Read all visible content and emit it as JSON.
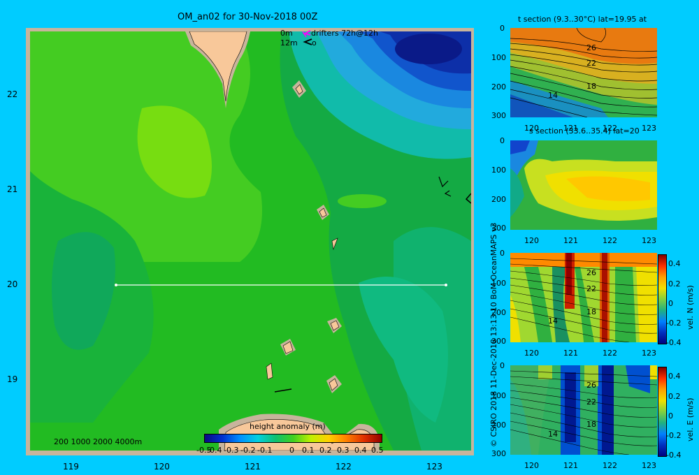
{
  "map": {
    "title": "OM_an02 for 30-Nov-2018 00Z",
    "legend_0m": "0m",
    "legend_drifters": "drifters 72h@12h",
    "legend_12m": "12m",
    "legend_12m_sym": "o",
    "lat_ticks": [
      "22",
      "21",
      "20",
      "19"
    ],
    "lon_ticks": [
      "119",
      "120",
      "121",
      "122",
      "123"
    ],
    "bathy_legend": "200  1000  2000  4000m",
    "colorbar_title": "height anomaly  (m)",
    "colorbar_ticks": [
      "-0.5",
      "-0.4",
      "-0.3",
      "-0.2",
      "-0.1",
      "0",
      "0.1",
      "0.2",
      "0.3",
      "0.4",
      "0.5"
    ]
  },
  "credit": "© CSIRO 2018   11-Dec-2018 13:13:10 BoM OceanMAPS v3",
  "panels": [
    {
      "title": "t section (9.3..30°C) lat=19.95 at",
      "y_ticks": [
        "0",
        "100",
        "200",
        "300"
      ],
      "x_ticks": [
        "120",
        "121",
        "122",
        "123"
      ],
      "contour_labels": [
        "26",
        "22",
        "18",
        "14"
      ],
      "colorbar": null
    },
    {
      "title": "s section (33.6..35.4) lat=20",
      "y_ticks": [
        "0",
        "100",
        "200",
        "300"
      ],
      "x_ticks": [
        "120",
        "121",
        "122",
        "123"
      ],
      "contour_labels": [],
      "colorbar": null
    },
    {
      "title": "",
      "y_ticks": [
        "0",
        "100",
        "200",
        "300"
      ],
      "x_ticks": [
        "120",
        "121",
        "122",
        "123"
      ],
      "contour_labels": [
        "26",
        "22",
        "18",
        "14"
      ],
      "colorbar": {
        "label": "vel. N  (m/s)",
        "ticks": [
          "0.4",
          "0.2",
          "0",
          "-0.2",
          "-0.4"
        ]
      }
    },
    {
      "title": "",
      "y_ticks": [
        "0",
        "100",
        "200",
        "300"
      ],
      "x_ticks": [
        "120",
        "121",
        "122",
        "123"
      ],
      "contour_labels": [
        "26",
        "22",
        "18",
        "14"
      ],
      "colorbar": {
        "label": "vel. E  (m/s)",
        "ticks": [
          "0.4",
          "0.2",
          "0",
          "-0.2",
          "-0.4"
        ]
      }
    }
  ],
  "colors": {
    "background": "#00ccff",
    "land": "#f8c89a",
    "frame": "#c8b49c"
  }
}
